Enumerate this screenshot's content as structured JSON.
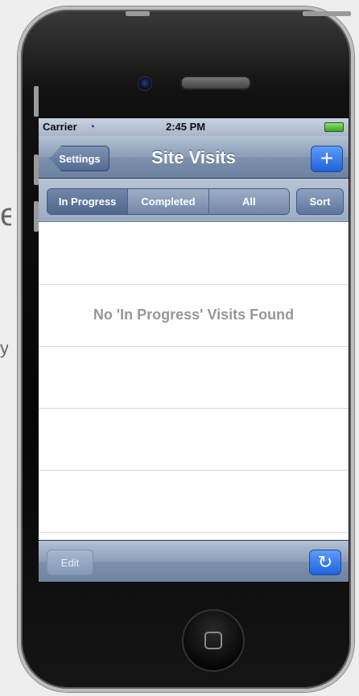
{
  "background": {
    "left_text_fragments": [
      "e",
      "y"
    ]
  },
  "status_bar": {
    "carrier": "Carrier",
    "wifi_icon": "wifi-icon",
    "time": "2:45 PM",
    "battery_icon": "battery-icon"
  },
  "nav_bar": {
    "back_button": "Settings",
    "title": "Site Visits",
    "add_button": "+"
  },
  "filter_bar": {
    "segments": [
      {
        "label": "In Progress",
        "selected": true
      },
      {
        "label": "Completed",
        "selected": false
      },
      {
        "label": "All",
        "selected": false
      }
    ],
    "sort_button": "Sort"
  },
  "list": {
    "empty_message": "No 'In Progress' Visits Found",
    "rows": 5
  },
  "toolbar": {
    "edit_button": "Edit",
    "refresh_icon": "refresh-icon"
  }
}
